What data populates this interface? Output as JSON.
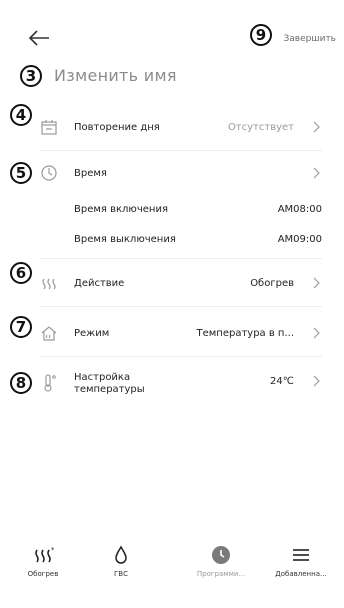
{
  "header": {
    "finish_label": "Завершить"
  },
  "name": {
    "placeholder": "Изменить имя"
  },
  "rows": {
    "repeat": {
      "label": "Повторение дня",
      "value": "Отсутствует"
    },
    "time": {
      "label": "Время"
    },
    "on_time": {
      "label": "Время включения",
      "value": "AM08:00"
    },
    "off_time": {
      "label": "Время выключения",
      "value": "AM09:00"
    },
    "action": {
      "label": "Действие",
      "value": "Обогрев"
    },
    "mode": {
      "label": "Режим",
      "value": "Температура в п..."
    },
    "temperature": {
      "label": "Настройка температуры",
      "value": "24℃"
    }
  },
  "badges": [
    "3",
    "4",
    "5",
    "6",
    "7",
    "8",
    "9"
  ],
  "tabs": [
    {
      "label": "Обогрев",
      "icon": "heating-icon"
    },
    {
      "label": "ГВС",
      "icon": "water-drop-icon"
    },
    {
      "label": "Программи...",
      "icon": "clock-icon"
    },
    {
      "label": "Добавленна...",
      "icon": "menu-icon"
    }
  ],
  "colors": {
    "icon_gray": "#9a9a9a",
    "text": "#222222",
    "muted": "#9a9a9a",
    "divider": "#ececec"
  }
}
